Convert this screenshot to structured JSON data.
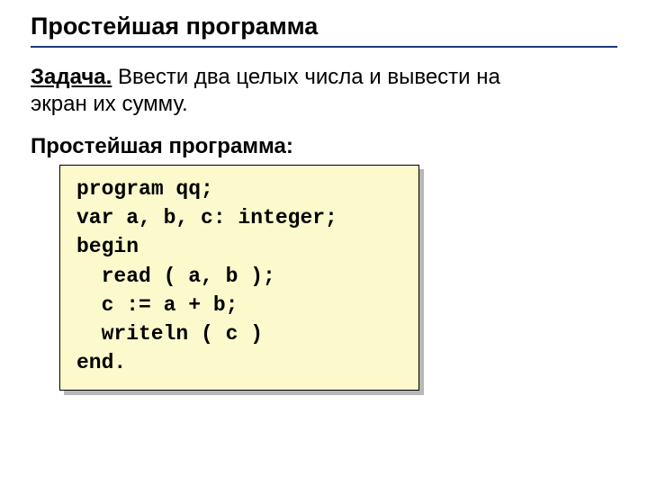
{
  "title": "Простейшая программа",
  "task": {
    "label": "Задача.",
    "text_line1": " Ввести два целых числа и вывести на",
    "text_line2": "экран их сумму."
  },
  "subtitle": "Простейшая программа:",
  "code": {
    "lines": [
      {
        "text": "program qq;",
        "indent": false
      },
      {
        "text": "var a, b, c: integer;",
        "indent": false
      },
      {
        "text": "begin",
        "indent": false
      },
      {
        "text": "read ( a, b );",
        "indent": true
      },
      {
        "text": "c := a + b;",
        "indent": true
      },
      {
        "text": "writeln ( c )",
        "indent": true
      },
      {
        "text": "end.",
        "indent": false
      }
    ]
  }
}
